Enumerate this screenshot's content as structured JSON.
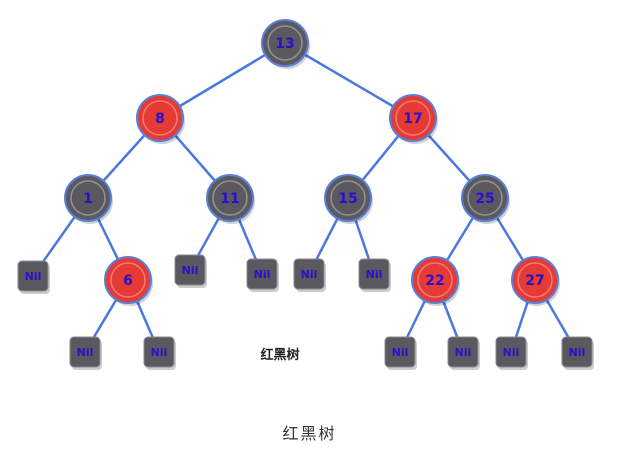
{
  "colors": {
    "red": "#e63a34",
    "black": "#59595f",
    "ring": "#5a7fd6",
    "edge": "#4a78e0",
    "label": "#2a10c8",
    "nil_label": "#2a10c8"
  },
  "nodes": [
    {
      "id": "n13",
      "label": "13",
      "color": "black",
      "parent": null
    },
    {
      "id": "n8",
      "label": "8",
      "color": "red",
      "parent": "n13"
    },
    {
      "id": "n17",
      "label": "17",
      "color": "red",
      "parent": "n13"
    },
    {
      "id": "n1",
      "label": "1",
      "color": "black",
      "parent": "n8"
    },
    {
      "id": "n11",
      "label": "11",
      "color": "black",
      "parent": "n8"
    },
    {
      "id": "n15",
      "label": "15",
      "color": "black",
      "parent": "n17"
    },
    {
      "id": "n25",
      "label": "25",
      "color": "black",
      "parent": "n17"
    },
    {
      "id": "n6",
      "label": "6",
      "color": "red",
      "parent": "n1"
    },
    {
      "id": "n22",
      "label": "22",
      "color": "red",
      "parent": "n25"
    },
    {
      "id": "n27",
      "label": "27",
      "color": "red",
      "parent": "n25"
    }
  ],
  "nils": [
    {
      "id": "nil-1-left",
      "label": "Nil",
      "parent": "n1"
    },
    {
      "id": "nil-11-left",
      "label": "Nil",
      "parent": "n11"
    },
    {
      "id": "nil-11-right",
      "label": "Nil",
      "parent": "n11"
    },
    {
      "id": "nil-15-left",
      "label": "Nil",
      "parent": "n15"
    },
    {
      "id": "nil-15-right",
      "label": "Nil",
      "parent": "n15"
    },
    {
      "id": "nil-6-left",
      "label": "Nil",
      "parent": "n6"
    },
    {
      "id": "nil-6-right",
      "label": "Nil",
      "parent": "n6"
    },
    {
      "id": "nil-22-left",
      "label": "Nil",
      "parent": "n22"
    },
    {
      "id": "nil-22-right",
      "label": "Nil",
      "parent": "n22"
    },
    {
      "id": "nil-27-left",
      "label": "Nil",
      "parent": "n27"
    },
    {
      "id": "nil-27-right",
      "label": "Nil",
      "parent": "n27"
    }
  ],
  "inner_caption": "红黑树",
  "caption": "红黑树"
}
